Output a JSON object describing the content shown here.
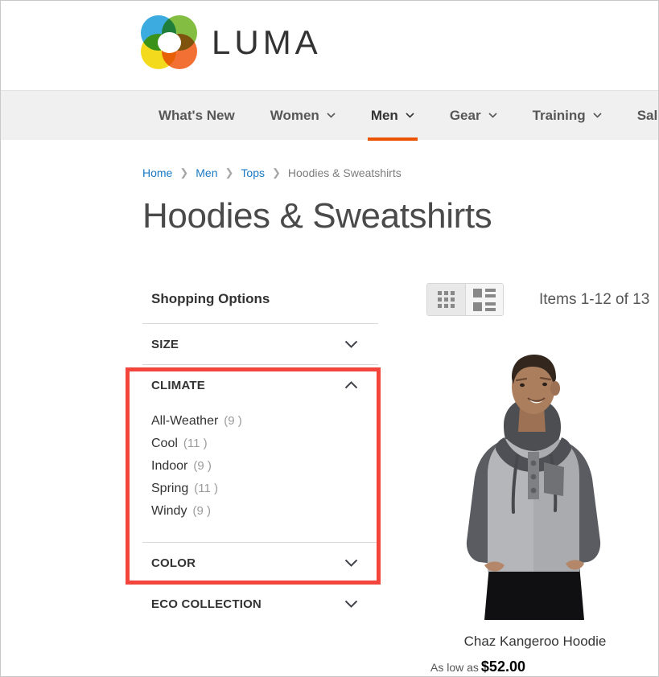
{
  "brand": {
    "name": "LUMA",
    "logo_icon": "luma-flower-logo",
    "colors": {
      "blue": "#2da5dd",
      "green": "#79b833",
      "yellow": "#f4d70b",
      "orange": "#f26524"
    }
  },
  "nav": {
    "accent_color": "#eb5202",
    "items": [
      {
        "label": "What's New",
        "has_caret": false,
        "active": false
      },
      {
        "label": "Women",
        "has_caret": true,
        "active": false
      },
      {
        "label": "Men",
        "has_caret": true,
        "active": true
      },
      {
        "label": "Gear",
        "has_caret": true,
        "active": false
      },
      {
        "label": "Training",
        "has_caret": true,
        "active": false
      },
      {
        "label": "Sale",
        "has_caret": false,
        "active": false
      }
    ]
  },
  "breadcrumb": {
    "separator": "❯",
    "links": [
      {
        "label": "Home"
      },
      {
        "label": "Men"
      },
      {
        "label": "Tops"
      }
    ],
    "current": "Hoodies & Sweatshirts",
    "link_color": "#1979c3"
  },
  "page": {
    "title": "Hoodies & Sweatshirts"
  },
  "sidebar": {
    "heading": "Shopping Options",
    "filters": [
      {
        "title": "SIZE",
        "expanded": false,
        "chevron_icon": "chevron-down-icon",
        "options": []
      },
      {
        "title": "CLIMATE",
        "expanded": true,
        "chevron_icon": "chevron-up-icon",
        "options": [
          {
            "label": "All-Weather",
            "count": "(9 )"
          },
          {
            "label": "Cool",
            "count": "(11 )"
          },
          {
            "label": "Indoor",
            "count": "(9 )"
          },
          {
            "label": "Spring",
            "count": "(11 )"
          },
          {
            "label": "Windy",
            "count": "(9 )"
          }
        ]
      },
      {
        "title": "COLOR",
        "expanded": false,
        "chevron_icon": "chevron-down-icon",
        "options": []
      },
      {
        "title": "ECO COLLECTION",
        "expanded": false,
        "chevron_icon": "chevron-down-icon",
        "options": []
      }
    ]
  },
  "annotation": {
    "highlight_color": "#f4453c",
    "target": "CLIMATE filter section"
  },
  "toolbar": {
    "grid_view_icon": "grid-view-icon",
    "list_view_icon": "list-view-icon",
    "active_view": "grid",
    "items_count": "Items 1-12 of 13"
  },
  "products": [
    {
      "name": "Chaz Kangeroo Hoodie",
      "price_label": "As low as",
      "price_value": "$52.00",
      "image_alt": "male-model-gray-hoodie-photo"
    }
  ]
}
